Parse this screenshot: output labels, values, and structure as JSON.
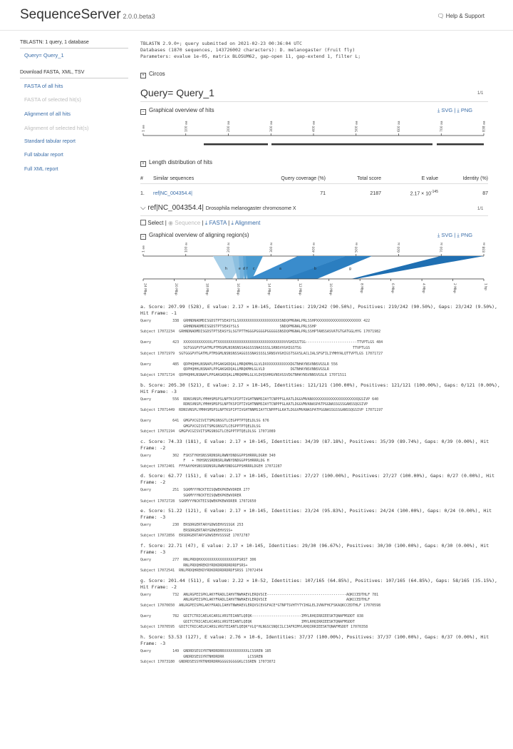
{
  "header": {
    "app_name": "SequenceServer",
    "version": "2.0.0.beta3",
    "help_label": "Help & Support"
  },
  "sidebar": {
    "summary": "TBLASTN: 1 query, 1 database",
    "query_link": "Query= Query_1",
    "download_heading": "Download FASTA, XML, TSV",
    "links": [
      {
        "label": "FASTA of all hits",
        "enabled": true
      },
      {
        "label": "FASTA of selected hit(s)",
        "enabled": false
      },
      {
        "label": "Alignment of all hits",
        "enabled": true
      },
      {
        "label": "Alignment of selected hit(s)",
        "enabled": false
      },
      {
        "label": "Standard tabular report",
        "enabled": true
      },
      {
        "label": "Full tabular report",
        "enabled": true
      },
      {
        "label": "Full XML report",
        "enabled": true
      }
    ]
  },
  "meta": {
    "line1": "TBLASTN 2.9.0+; query submitted on 2021-02-23 00:36:04 UTC",
    "line2": "Databases (1870 sequences, 143726002 characters): D. melanogaster (Fruit fly)",
    "line3": "Parameters: evalue 1e-05, matrix BLOSUM62, gap-open 11, gap-extend 1, filter L;"
  },
  "circos_label": "Circos",
  "query": {
    "title": "Query= Query_1",
    "pager": "1/1"
  },
  "overview": {
    "title": "Graphical overview of hits",
    "svg": "SVG",
    "png": "PNG",
    "ticks": [
      "1 aa",
      "100 aa",
      "200 aa",
      "300 aa",
      "400 aa",
      "500 aa",
      "600 aa",
      "700 aa",
      "838 aa"
    ]
  },
  "length_dist_label": "Length distribution of hits",
  "hits_table": {
    "headers": [
      "#",
      "Similar sequences",
      "Query coverage (%)",
      "Total score",
      "E value",
      "Identity (%)"
    ],
    "rows": [
      {
        "num": "1.",
        "id": "ref|NC_004354.4|",
        "coverage": "71",
        "score": "2187",
        "evalue_base": "2.17 × 10",
        "evalue_exp": "-145",
        "identity": "87"
      }
    ]
  },
  "subject": {
    "id": "ref|NC_004354.4|",
    "desc": "Drosophila melanogaster chromosome X",
    "pager": "1/1",
    "select": "Select",
    "sequence": "Sequence",
    "fasta": "FASTA",
    "alignment": "Alignment"
  },
  "region": {
    "title": "Graphical overview of aligning region(s)",
    "svg": "SVG",
    "png": "PNG",
    "q_ticks": [
      "1 aa",
      "100 aa",
      "200 aa",
      "300 aa",
      "400 aa",
      "500 aa",
      "600 aa",
      "700 aa",
      "838 aa"
    ],
    "s_ticks": [
      "24 Mbp",
      "20 Mbp",
      "18 Mbp",
      "16 Mbp",
      "14 Mbp",
      "12 Mbp",
      "10 Mbp",
      "8 Mbp",
      "6 Mbp",
      "4 Mbp",
      "2 Mbp",
      "1 bp"
    ],
    "hsp_letters": [
      "h",
      "e",
      "d",
      "f",
      "c",
      "a",
      "b",
      "g"
    ]
  },
  "hsps": [
    {
      "label": "a.",
      "stats": "a. Score: 207.99 (528), E value: 2.17 × 10-145, Identities: 219/242 (90.50%), Positives: 219/242 (90.50%), Gaps: 23/242 (9.50%), Hit Frame: -1",
      "alignment": "Query          338  GRHNDNADMDISGDSTPTSEASYSLSXXXXXXXXXXXXXXXXXXXSNDQPMGNALPRLSSHPXXXXXXXXXXXXXXXXXXXXX 422\n                    GRHNDNADMDISGDSTPTSEASYSLS                   SNDQPMGNALPRLSSHP\nSubject 17072234  GRHNDNADMDISGDSTPTSEASYSLSGTPTTHGGGPGGGGPGGGGGSNSDQPMGNALPRLSSHPTANSSASVATGTGATGGLHYG 17071982\n\nQuery          423  XXXXXXXXXXXXXLPTXXXXXXXXXXXXXXXXXXXXXXXXXXXXXXXVVGHIGSTSG------------------------TTVPTLGS 484\n                    SGTGGGPVTGATMLPTMSGMLNSNSNSSAGGSSSNASSSSLSRNSVVGHIGSTSG                        TTVPTLGS\nSubject 17071979  SGTGGGPVTGATMLPTMSGMLNSNSNSSAGGSSSNASSSSLSRNSVVGHIGSTSGVSLACLIALSFGFILIYMHYALQTTVPTLGS 17071727\n\nQuery          485  QDPHQHHLNSNAPLPPGAKGKDQALLMRQKMHLGLVLDXXXXXXXXXXXXDGTNHAYNSVNNSVGSLR 556\n                    QDPHQHHLNSNAPLPPGAKGKDQALLMRQKMHLGLVLD            DGTNHAYNSVNNSVGSLR\nSubject 17071724  QDPHQHHLNSNAPLPPGAKGKDQALLMRQKMHLGLVLDVQSHHGVNSVGSVDGTNHAYNSVNNSVGSLR 17071511"
    },
    {
      "label": "b.",
      "stats": "b. Score: 205.30 (521), E value: 2.17 × 10-145, Identities: 121/121 (100.00%), Positives: 121/121 (100.00%), Gaps: 0/121 (0.00%), Hit Frame: -3",
      "alignment": "Query          556  RDNSVNSPLYMHHSMSPSLNPTKSPIPTIVGHTNNMSIAYTCNPPFGLKATLDGGVMVANXXXXXXXXXXXXXXXXXXXXXQGSIVP 640\n                    RDNSVNSPLYMHHSMSPSLNPTKSPIPTIVGHTNNMSIAYTCNPPFGLKATLDGGVMVANASPATPGGNASSGSSGANSSQGSIVP\nSubject 17071449  RDNSVNSPLYMHHSMSPSLNPTKSPIPTIVGHTNNMSIAYTCNPPFGLKATLDGGVMVANASPATPGGNASSGSSGANSSQGSIVP 17071197\n\nQuery          641  GMGPVCGISVITSMGSNSGTLCEGPPTPTQELDLSG 676\n                    GMGPVCGISVITSMGSNSGTLCEGPPTPTQELDLSG\nSubject 17071194  GMGPVCGISVITSMGSNSGTLCEGPPTPTQELDLSG 17071089"
    },
    {
      "label": "c.",
      "stats": "c. Score: 74.33 (181), E value: 2.17 × 10-145, Identities: 34/39 (87.18%), Positives: 35/39 (89.74%), Gaps: 0/39 (0.00%), Hit Frame: -2",
      "alignment": "Query          302  FSKSTYKHSNSSRDNSRLRWNYDNDGGPPSHRRRLDGRH 340\n                    F   + YKHSNSSRDNSRLRWNYDNDGGPPSHRRRLDG H\nSubject 17072401  FFFAAYKHSNSSRDNSRLRWNYDNDGGPPSHRRRLDGEH 17072287"
    },
    {
      "label": "d.",
      "stats": "d. Score: 62.77 (151), E value: 2.17 × 10-145, Identities: 27/27 (100.00%), Positives: 27/27 (100.00%), Gaps: 0/27 (0.00%), Hit Frame: -2",
      "alignment": "Query          251  SGKMYYYNCKTEISQWEKPKEWVDRER 277\n                    SGKMYYYNCKTEISQWEKPKEWVDRER\nSubject 17072728  SGKMYYYNCKTEISQWEKPKEWVDRER 17072650"
    },
    {
      "label": "e.",
      "stats": "e. Score: 51.22 (121), E value: 2.17 × 10-145, Identities: 23/24 (95.83%), Positives: 24/24 (100.00%), Gaps: 0/24 (0.00%), Hit Frame: -3",
      "alignment": "Query          230  ERSDRGERTARYGDWSEHVSSSGK 253\n                    ERSDRGERTARYGDWSEHVSSS+\nSubject 17072856  ERSDRGERTARYGDWSEHVSSSGE 17072787"
    },
    {
      "label": "f.",
      "stats": "f. Score: 22.71 (47), E value: 2.17 × 10-145, Identities: 29/30 (96.67%), Positives: 30/30 (100.00%), Gaps: 0/30 (0.00%), Hit Frame: -3",
      "alignment": "Query          277  RNLPRDQHXXXXXXXXXXXXXXXXXFSRST 306\n                    RNLPRDQHREKDYRDKDRDRDRDRDFSRS+\nSubject 17072541  RNLPRDQHREKDYRDKDRDRDRDRDFSRSS 17072454"
    },
    {
      "label": "g.",
      "stats": "g. Score: 201.44 (511), E value: 2.22 × 10-52, Identities: 107/165 (64.85%), Positives: 107/165 (64.85%), Gaps: 58/165 (35.15%), Hit Frame: -2",
      "alignment": "Query          732  ANLRGPEISPKLAKYFRADLIAHVTNWHAEVLERQVSCE-------------------------------------AQKCCEDTHLF 781\n                    ANLRGPEISPKLAKYFRADLIAHVTNWHAEVLERQVSCE                                     AQKCCEDTHLF\nSubject 17070650  ANLRGPEISPKLAKYFRADLIAHVTNWHAEVLERQVSCEVGFACE*GTNPTSVHTYTYIHGLELIVNVFHCFSKAQKCCEDTHLF 17070598\n\nQuery          782  GDITCTRICAELKCARSLVRSTEIANTLQEQK-----------------------IMYLRHQIRRIEESKTQNAFMSDDT 838\n                    GDITCTRICAELKCARSLVRSTEIANTLQEQK                       IMYLRHQIRRIEESKTQNAFMSDDT\nSubject 17070595  GDITCTRICAELKCARSLVRSTEIANTLQEQK*VLQ*HLNGSCSNQCILCIAFRIMYLRHQIRRIEESKTQNAFMSDDT 17070358"
    },
    {
      "label": "h.",
      "stats": "h. Score: 53.53 (127), E value: 2.76 × 10-6, Identities: 37/37 (100.00%), Positives: 37/37 (100.00%), Gaps: 0/37 (0.00%), Hit Frame: -3",
      "alignment": "Query          149  GNDRDSESSYRTNHDRDRRXXXXXXXXXXXLCSSREN 185\n                    GNDRDSESSYRTNHDRDRR           LCSSREN\nSubject 17073180  GNDRDSESSYRTNHDRDRRGGGGSGGGGKLCSSREN 17073072"
    }
  ],
  "colors": {
    "link": "#3a6da8",
    "hsp_light": "#a8cfe8",
    "hsp_mid": "#4a9bd1",
    "hsp_dark": "#1f6fb2"
  }
}
